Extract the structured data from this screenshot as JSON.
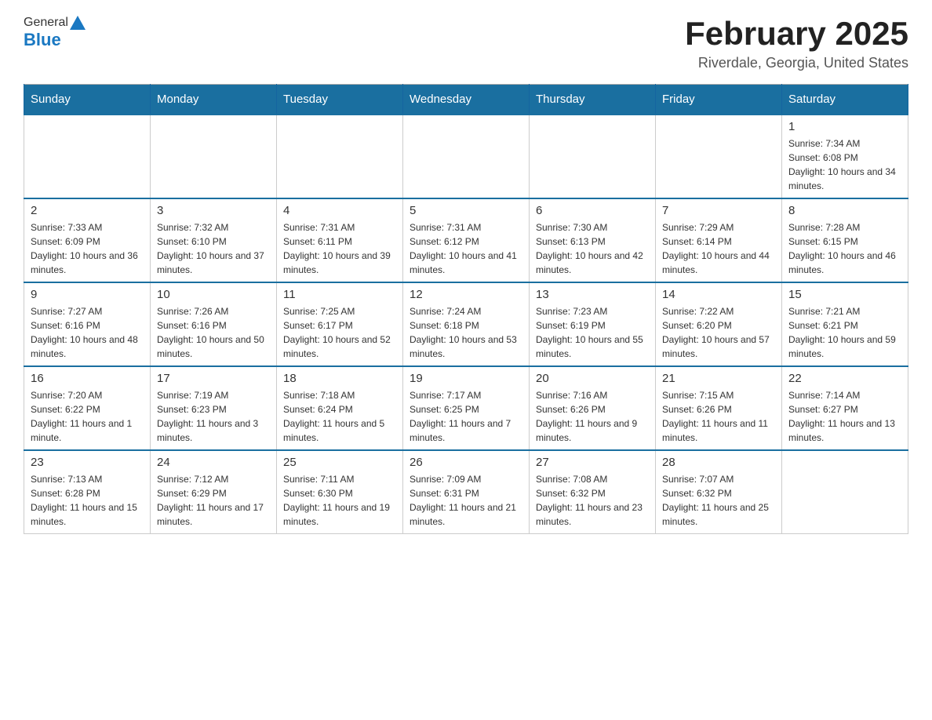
{
  "logo": {
    "general": "General",
    "blue": "Blue"
  },
  "title": "February 2025",
  "subtitle": "Riverdale, Georgia, United States",
  "days_of_week": [
    "Sunday",
    "Monday",
    "Tuesday",
    "Wednesday",
    "Thursday",
    "Friday",
    "Saturday"
  ],
  "weeks": [
    [
      {
        "day": "",
        "sunrise": "",
        "sunset": "",
        "daylight": ""
      },
      {
        "day": "",
        "sunrise": "",
        "sunset": "",
        "daylight": ""
      },
      {
        "day": "",
        "sunrise": "",
        "sunset": "",
        "daylight": ""
      },
      {
        "day": "",
        "sunrise": "",
        "sunset": "",
        "daylight": ""
      },
      {
        "day": "",
        "sunrise": "",
        "sunset": "",
        "daylight": ""
      },
      {
        "day": "",
        "sunrise": "",
        "sunset": "",
        "daylight": ""
      },
      {
        "day": "1",
        "sunrise": "Sunrise: 7:34 AM",
        "sunset": "Sunset: 6:08 PM",
        "daylight": "Daylight: 10 hours and 34 minutes."
      }
    ],
    [
      {
        "day": "2",
        "sunrise": "Sunrise: 7:33 AM",
        "sunset": "Sunset: 6:09 PM",
        "daylight": "Daylight: 10 hours and 36 minutes."
      },
      {
        "day": "3",
        "sunrise": "Sunrise: 7:32 AM",
        "sunset": "Sunset: 6:10 PM",
        "daylight": "Daylight: 10 hours and 37 minutes."
      },
      {
        "day": "4",
        "sunrise": "Sunrise: 7:31 AM",
        "sunset": "Sunset: 6:11 PM",
        "daylight": "Daylight: 10 hours and 39 minutes."
      },
      {
        "day": "5",
        "sunrise": "Sunrise: 7:31 AM",
        "sunset": "Sunset: 6:12 PM",
        "daylight": "Daylight: 10 hours and 41 minutes."
      },
      {
        "day": "6",
        "sunrise": "Sunrise: 7:30 AM",
        "sunset": "Sunset: 6:13 PM",
        "daylight": "Daylight: 10 hours and 42 minutes."
      },
      {
        "day": "7",
        "sunrise": "Sunrise: 7:29 AM",
        "sunset": "Sunset: 6:14 PM",
        "daylight": "Daylight: 10 hours and 44 minutes."
      },
      {
        "day": "8",
        "sunrise": "Sunrise: 7:28 AM",
        "sunset": "Sunset: 6:15 PM",
        "daylight": "Daylight: 10 hours and 46 minutes."
      }
    ],
    [
      {
        "day": "9",
        "sunrise": "Sunrise: 7:27 AM",
        "sunset": "Sunset: 6:16 PM",
        "daylight": "Daylight: 10 hours and 48 minutes."
      },
      {
        "day": "10",
        "sunrise": "Sunrise: 7:26 AM",
        "sunset": "Sunset: 6:16 PM",
        "daylight": "Daylight: 10 hours and 50 minutes."
      },
      {
        "day": "11",
        "sunrise": "Sunrise: 7:25 AM",
        "sunset": "Sunset: 6:17 PM",
        "daylight": "Daylight: 10 hours and 52 minutes."
      },
      {
        "day": "12",
        "sunrise": "Sunrise: 7:24 AM",
        "sunset": "Sunset: 6:18 PM",
        "daylight": "Daylight: 10 hours and 53 minutes."
      },
      {
        "day": "13",
        "sunrise": "Sunrise: 7:23 AM",
        "sunset": "Sunset: 6:19 PM",
        "daylight": "Daylight: 10 hours and 55 minutes."
      },
      {
        "day": "14",
        "sunrise": "Sunrise: 7:22 AM",
        "sunset": "Sunset: 6:20 PM",
        "daylight": "Daylight: 10 hours and 57 minutes."
      },
      {
        "day": "15",
        "sunrise": "Sunrise: 7:21 AM",
        "sunset": "Sunset: 6:21 PM",
        "daylight": "Daylight: 10 hours and 59 minutes."
      }
    ],
    [
      {
        "day": "16",
        "sunrise": "Sunrise: 7:20 AM",
        "sunset": "Sunset: 6:22 PM",
        "daylight": "Daylight: 11 hours and 1 minute."
      },
      {
        "day": "17",
        "sunrise": "Sunrise: 7:19 AM",
        "sunset": "Sunset: 6:23 PM",
        "daylight": "Daylight: 11 hours and 3 minutes."
      },
      {
        "day": "18",
        "sunrise": "Sunrise: 7:18 AM",
        "sunset": "Sunset: 6:24 PM",
        "daylight": "Daylight: 11 hours and 5 minutes."
      },
      {
        "day": "19",
        "sunrise": "Sunrise: 7:17 AM",
        "sunset": "Sunset: 6:25 PM",
        "daylight": "Daylight: 11 hours and 7 minutes."
      },
      {
        "day": "20",
        "sunrise": "Sunrise: 7:16 AM",
        "sunset": "Sunset: 6:26 PM",
        "daylight": "Daylight: 11 hours and 9 minutes."
      },
      {
        "day": "21",
        "sunrise": "Sunrise: 7:15 AM",
        "sunset": "Sunset: 6:26 PM",
        "daylight": "Daylight: 11 hours and 11 minutes."
      },
      {
        "day": "22",
        "sunrise": "Sunrise: 7:14 AM",
        "sunset": "Sunset: 6:27 PM",
        "daylight": "Daylight: 11 hours and 13 minutes."
      }
    ],
    [
      {
        "day": "23",
        "sunrise": "Sunrise: 7:13 AM",
        "sunset": "Sunset: 6:28 PM",
        "daylight": "Daylight: 11 hours and 15 minutes."
      },
      {
        "day": "24",
        "sunrise": "Sunrise: 7:12 AM",
        "sunset": "Sunset: 6:29 PM",
        "daylight": "Daylight: 11 hours and 17 minutes."
      },
      {
        "day": "25",
        "sunrise": "Sunrise: 7:11 AM",
        "sunset": "Sunset: 6:30 PM",
        "daylight": "Daylight: 11 hours and 19 minutes."
      },
      {
        "day": "26",
        "sunrise": "Sunrise: 7:09 AM",
        "sunset": "Sunset: 6:31 PM",
        "daylight": "Daylight: 11 hours and 21 minutes."
      },
      {
        "day": "27",
        "sunrise": "Sunrise: 7:08 AM",
        "sunset": "Sunset: 6:32 PM",
        "daylight": "Daylight: 11 hours and 23 minutes."
      },
      {
        "day": "28",
        "sunrise": "Sunrise: 7:07 AM",
        "sunset": "Sunset: 6:32 PM",
        "daylight": "Daylight: 11 hours and 25 minutes."
      },
      {
        "day": "",
        "sunrise": "",
        "sunset": "",
        "daylight": ""
      }
    ]
  ]
}
